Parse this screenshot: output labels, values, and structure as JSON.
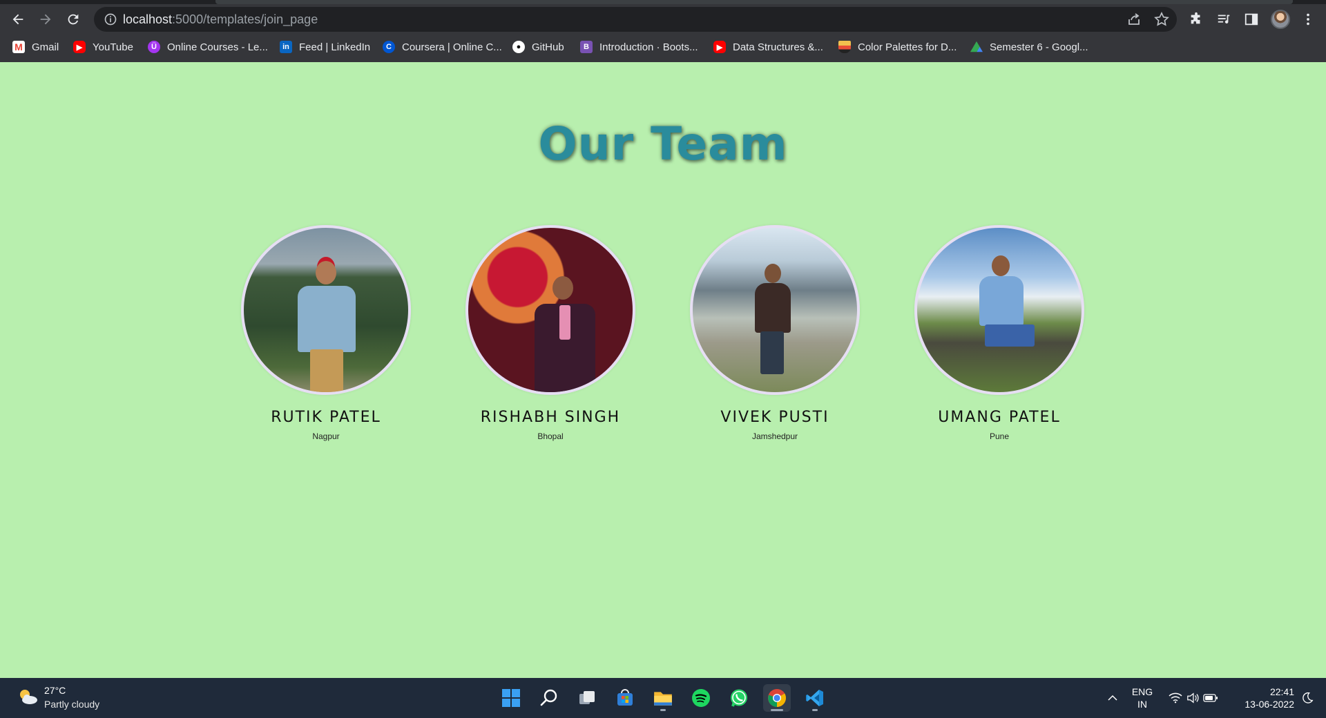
{
  "browser": {
    "url_host": "localhost",
    "url_path": ":5000/templates/join_page"
  },
  "bookmarks": [
    {
      "label": "Gmail",
      "icon": "gmail-icon",
      "color": "#ea4335"
    },
    {
      "label": "YouTube",
      "icon": "youtube-icon",
      "color": "#ff0000"
    },
    {
      "label": "Online Courses - Le...",
      "icon": "udemy-icon",
      "color": "#a435f0"
    },
    {
      "label": "Feed | LinkedIn",
      "icon": "linkedin-icon",
      "color": "#0a66c2"
    },
    {
      "label": "Coursera | Online C...",
      "icon": "coursera-icon",
      "color": "#0056d2"
    },
    {
      "label": "GitHub",
      "icon": "github-icon",
      "color": "#ffffff"
    },
    {
      "label": "Introduction · Boots...",
      "icon": "bootstrap-icon",
      "color": "#7952b3"
    },
    {
      "label": "Data Structures &...",
      "icon": "youtube-icon",
      "color": "#ff0000"
    },
    {
      "label": "Color Palettes for D...",
      "icon": "palette-icon",
      "color": "#f2c14e"
    },
    {
      "label": "Semester 6 - Googl...",
      "icon": "google-drive-icon",
      "color": "#34a853"
    }
  ],
  "page": {
    "title": "Our Team",
    "background": "#b8efae",
    "title_color": "#2a8c9c"
  },
  "team": [
    {
      "name": "RUTIK PATEL",
      "city": "Nagpur"
    },
    {
      "name": "RISHABH SINGH",
      "city": "Bhopal"
    },
    {
      "name": "VIVEK PUSTI",
      "city": "Jamshedpur"
    },
    {
      "name": "UMANG PATEL",
      "city": "Pune"
    }
  ],
  "taskbar": {
    "weather_temp": "27°C",
    "weather_desc": "Partly cloudy",
    "apps": [
      "windows-start-icon",
      "search-icon",
      "task-view-icon",
      "microsoft-store-icon",
      "file-explorer-icon",
      "spotify-icon",
      "whatsapp-icon",
      "chrome-icon",
      "vscode-icon"
    ],
    "lang_line1": "ENG",
    "lang_line2": "IN",
    "time": "22:41",
    "date": "13-06-2022"
  }
}
